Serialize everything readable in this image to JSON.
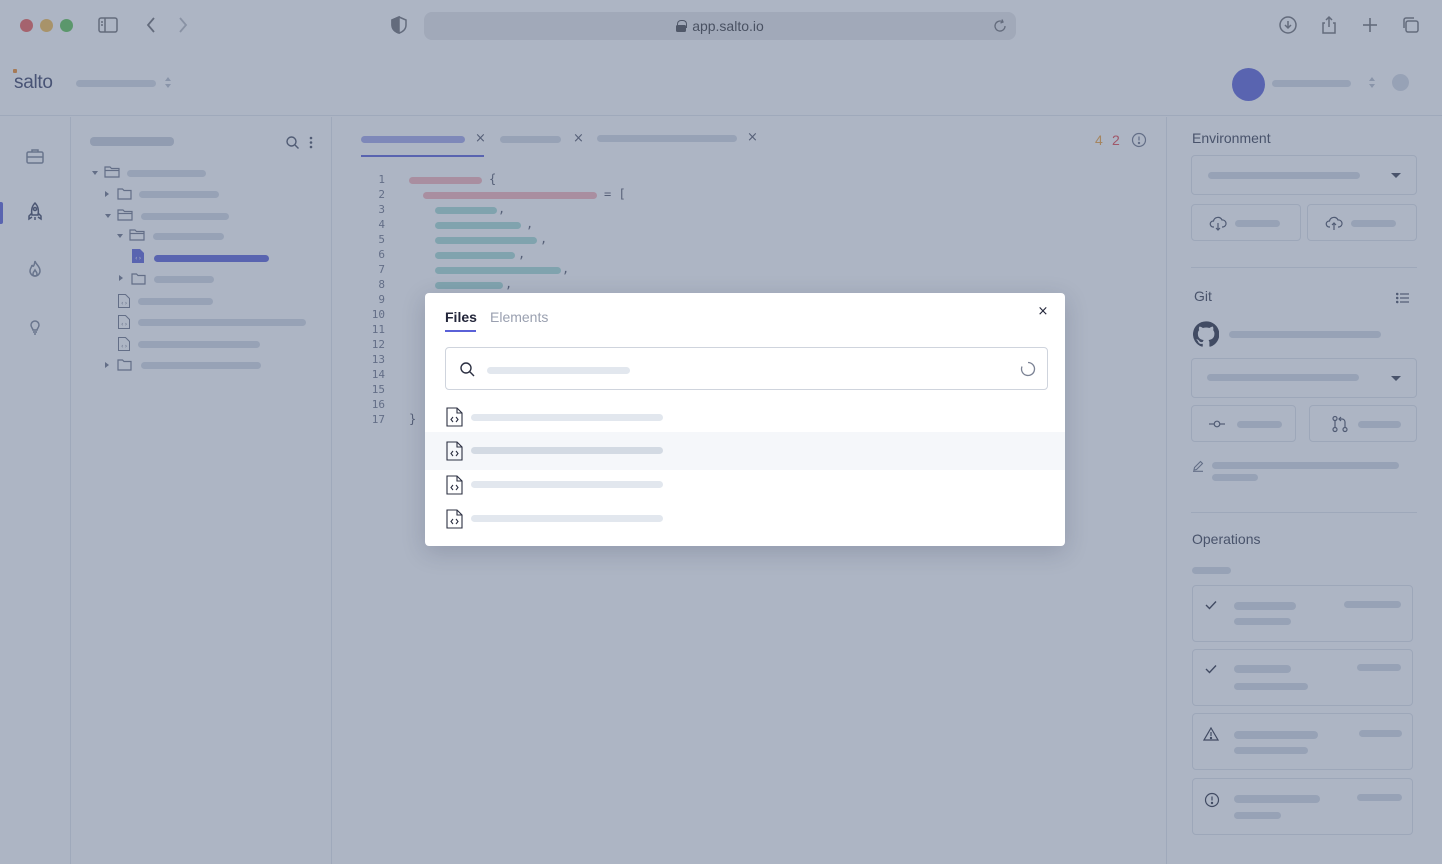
{
  "browser": {
    "url": "app.salto.io"
  },
  "app": {
    "logo_text": "salto",
    "colors": {
      "accent": "#5a61d8",
      "warning_count": "#f0a23b",
      "error_count": "#e5484d",
      "overlay": "rgba(87,104,134,0.49)"
    }
  },
  "editor": {
    "tab_close_glyph": "×",
    "warning_count": "4",
    "error_count": "2",
    "line_numbers": [
      "1",
      "2",
      "3",
      "4",
      "5",
      "6",
      "7",
      "8",
      "9",
      "10",
      "11",
      "12",
      "13",
      "14",
      "15",
      "16",
      "17"
    ],
    "open_brace": "{",
    "assign_bracket": "= [",
    "close_brace": "}",
    "comma": ","
  },
  "right_panel": {
    "environment_title": "Environment",
    "git_title": "Git",
    "operations_title": "Operations"
  },
  "icons": {
    "rail": [
      "briefcase-icon",
      "rocket-icon",
      "flame-icon",
      "lightbulb-icon"
    ],
    "right_panel": [
      "cloud-download-icon",
      "cloud-upload-icon",
      "github-icon",
      "commit-icon",
      "pull-request-icon",
      "pencil-icon",
      "list-icon",
      "check-icon",
      "warning-icon",
      "alert-circle-icon"
    ]
  },
  "modal": {
    "tabs": [
      {
        "label": "Files",
        "active": true
      },
      {
        "label": "Elements",
        "active": false
      }
    ],
    "close_glyph": "×",
    "search": {
      "value": "",
      "placeholder": ""
    },
    "results_count": 4,
    "highlighted_result": 2
  }
}
